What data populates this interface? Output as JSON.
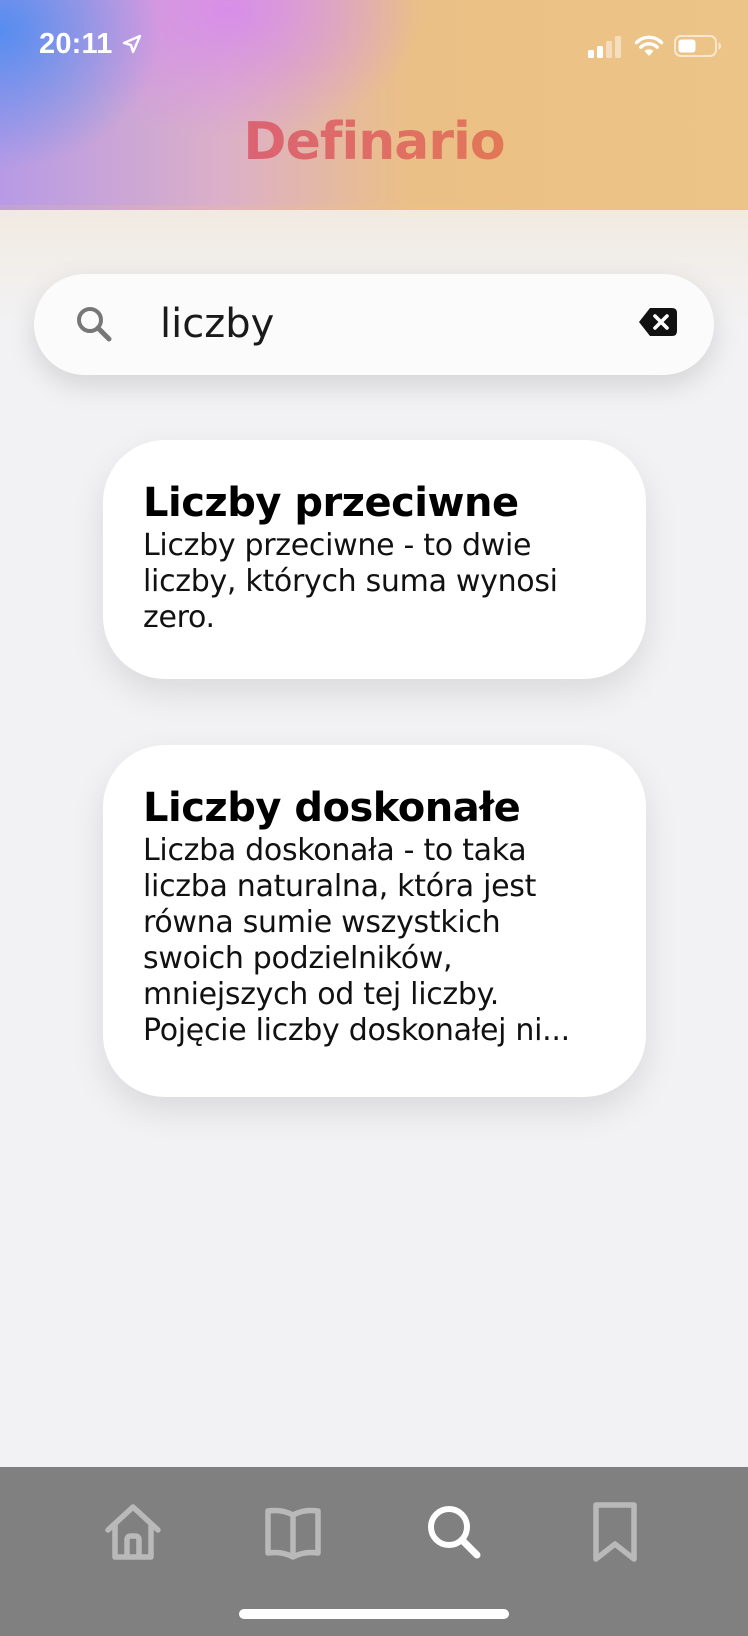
{
  "status_bar": {
    "time": "20:11",
    "icons": [
      "location-arrow-icon",
      "signal-icon",
      "wifi-icon",
      "battery-icon"
    ]
  },
  "app": {
    "title": "Definario",
    "title_gradient": [
      "#d24e88",
      "#e78a3a"
    ]
  },
  "search": {
    "value": "liczby",
    "icon": "search-icon",
    "clear_icon": "clear-icon"
  },
  "results": [
    {
      "title": "Liczby przeciwne",
      "text": "Liczby przeciwne - to dwie liczby, których suma wynosi zero."
    },
    {
      "title": "Liczby doskonałe",
      "text_lines": [
        "Liczba doskonała - to taka liczba naturalna, która jest równa sumie wszystkich swoich podzielników, mniejszych od tej liczby.",
        "Pojęcie liczby doskonałej ni..."
      ]
    }
  ],
  "tab_bar": {
    "background": "#808080",
    "tabs": [
      {
        "icon": "home-icon",
        "active": false
      },
      {
        "icon": "book-icon",
        "active": false
      },
      {
        "icon": "search-icon",
        "active": true
      },
      {
        "icon": "bookmark-icon",
        "active": false
      }
    ]
  }
}
